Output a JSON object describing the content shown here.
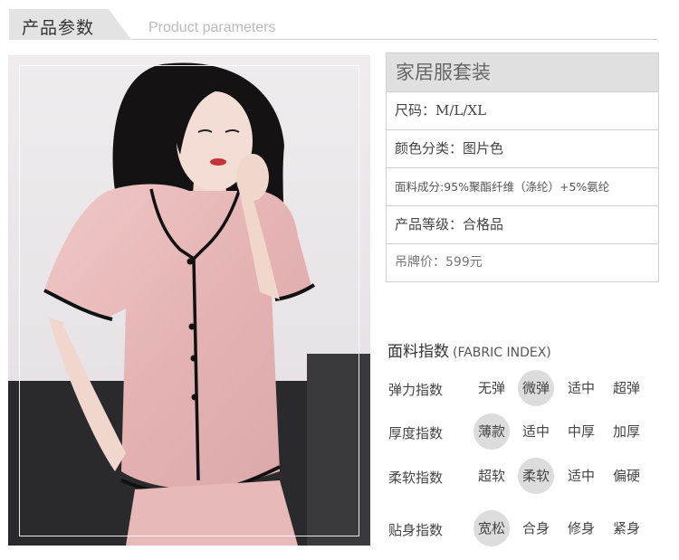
{
  "header": {
    "title_cn": "产品参数",
    "title_en": "Product parameters"
  },
  "photo": {
    "description_icon": "model-photo",
    "colors": {
      "garment": "#e9bcbc",
      "piping": "#111111",
      "background": "#ebe8ea"
    }
  },
  "product": {
    "name": "家居服套装",
    "rows": [
      {
        "label": "尺码：",
        "value": "M/L/XL"
      },
      {
        "label": "颜色分类：",
        "value": "图片色"
      },
      {
        "label": "面料成分:",
        "value": "95%聚酯纤维（涤纶）+5%氨纶"
      },
      {
        "label": "产品等级：",
        "value": "合格品"
      },
      {
        "label": "吊牌价：",
        "value": "599元"
      }
    ]
  },
  "fabric_index": {
    "title": "面料指数",
    "title_en": "(FABRIC INDEX)",
    "rows": [
      {
        "label": "弹力指数",
        "options": [
          "无弹",
          "微弹",
          "适中",
          "超弹"
        ],
        "selected": 1
      },
      {
        "label": "厚度指数",
        "options": [
          "薄款",
          "适中",
          "中厚",
          "加厚"
        ],
        "selected": 0
      },
      {
        "label": "柔软指数",
        "options": [
          "超软",
          "柔软",
          "适中",
          "偏硬"
        ],
        "selected": 1
      },
      {
        "label": "贴身指数",
        "options": [
          "宽松",
          "合身",
          "修身",
          "紧身"
        ],
        "selected": 0
      }
    ]
  }
}
